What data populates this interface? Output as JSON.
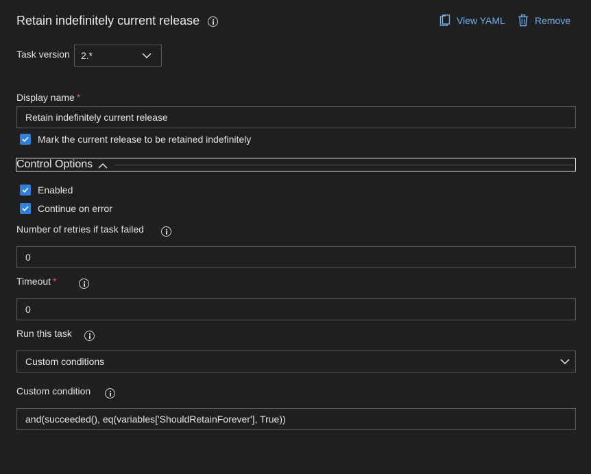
{
  "header": {
    "title": "Retain indefinitely current release",
    "view_yaml_label": "View YAML",
    "remove_label": "Remove"
  },
  "task_version": {
    "label": "Task version",
    "value": "2.*"
  },
  "display_name": {
    "label": "Display name",
    "required_mark": "*",
    "value": "Retain indefinitely current release"
  },
  "mark_retained": {
    "label": "Mark the current release to be retained indefinitely",
    "checked": true
  },
  "control_options": {
    "label": "Control Options",
    "expanded": true
  },
  "enabled": {
    "label": "Enabled",
    "checked": true
  },
  "continue_on_error": {
    "label": "Continue on error",
    "checked": true
  },
  "retries": {
    "label": "Number of retries if task failed",
    "value": "0"
  },
  "timeout": {
    "label": "Timeout",
    "required_mark": "*",
    "value": "0"
  },
  "run_this_task": {
    "label": "Run this task",
    "value": "Custom conditions"
  },
  "custom_condition": {
    "label": "Custom condition",
    "value": "and(succeeded(), eq(variables['ShouldRetainForever'], True))"
  },
  "colors": {
    "background": "#1f1f1f",
    "accent": "#6cb2f2",
    "checkbox": "#2f80d8",
    "required": "#e05a5a"
  }
}
